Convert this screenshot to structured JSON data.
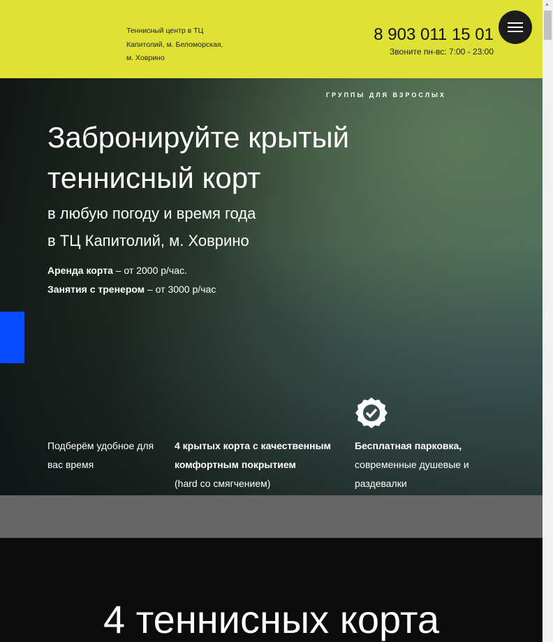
{
  "header": {
    "address_lines": [
      "Теннисный центр в ТЦ",
      "Капитолий, м. Беломорская,",
      "м. Ховрино"
    ],
    "phone": "8 903 011 15 01",
    "hours": "Звоните пн-вс: 7:00 - 23:00"
  },
  "hero": {
    "kicker": "ГРУППЫ ДЛЯ ВЗРОСЛЫХ",
    "title": "Забронируйте крытый теннисный корт",
    "subtitle_1": "в любую погоду и время года",
    "subtitle_2": "в ТЦ Капитолий, м. Ховрино",
    "price_1_label": "Аренда корта",
    "price_1_value": " – от 2000 р/час.",
    "price_2_label": "Занятия с тренером",
    "price_2_value": " – от 3000 р/час",
    "features": {
      "f1": "Подберём удобное для вас время",
      "f2_bold": "4 крытых корта с качественным комфортным покрытием",
      "f2_rest": "(hard со смягчением)",
      "f3_bold": "Бесплатная парковка,",
      "f3_rest": "современные душевые и раздевалки"
    }
  },
  "section": {
    "title": "4 теннисных корта"
  }
}
